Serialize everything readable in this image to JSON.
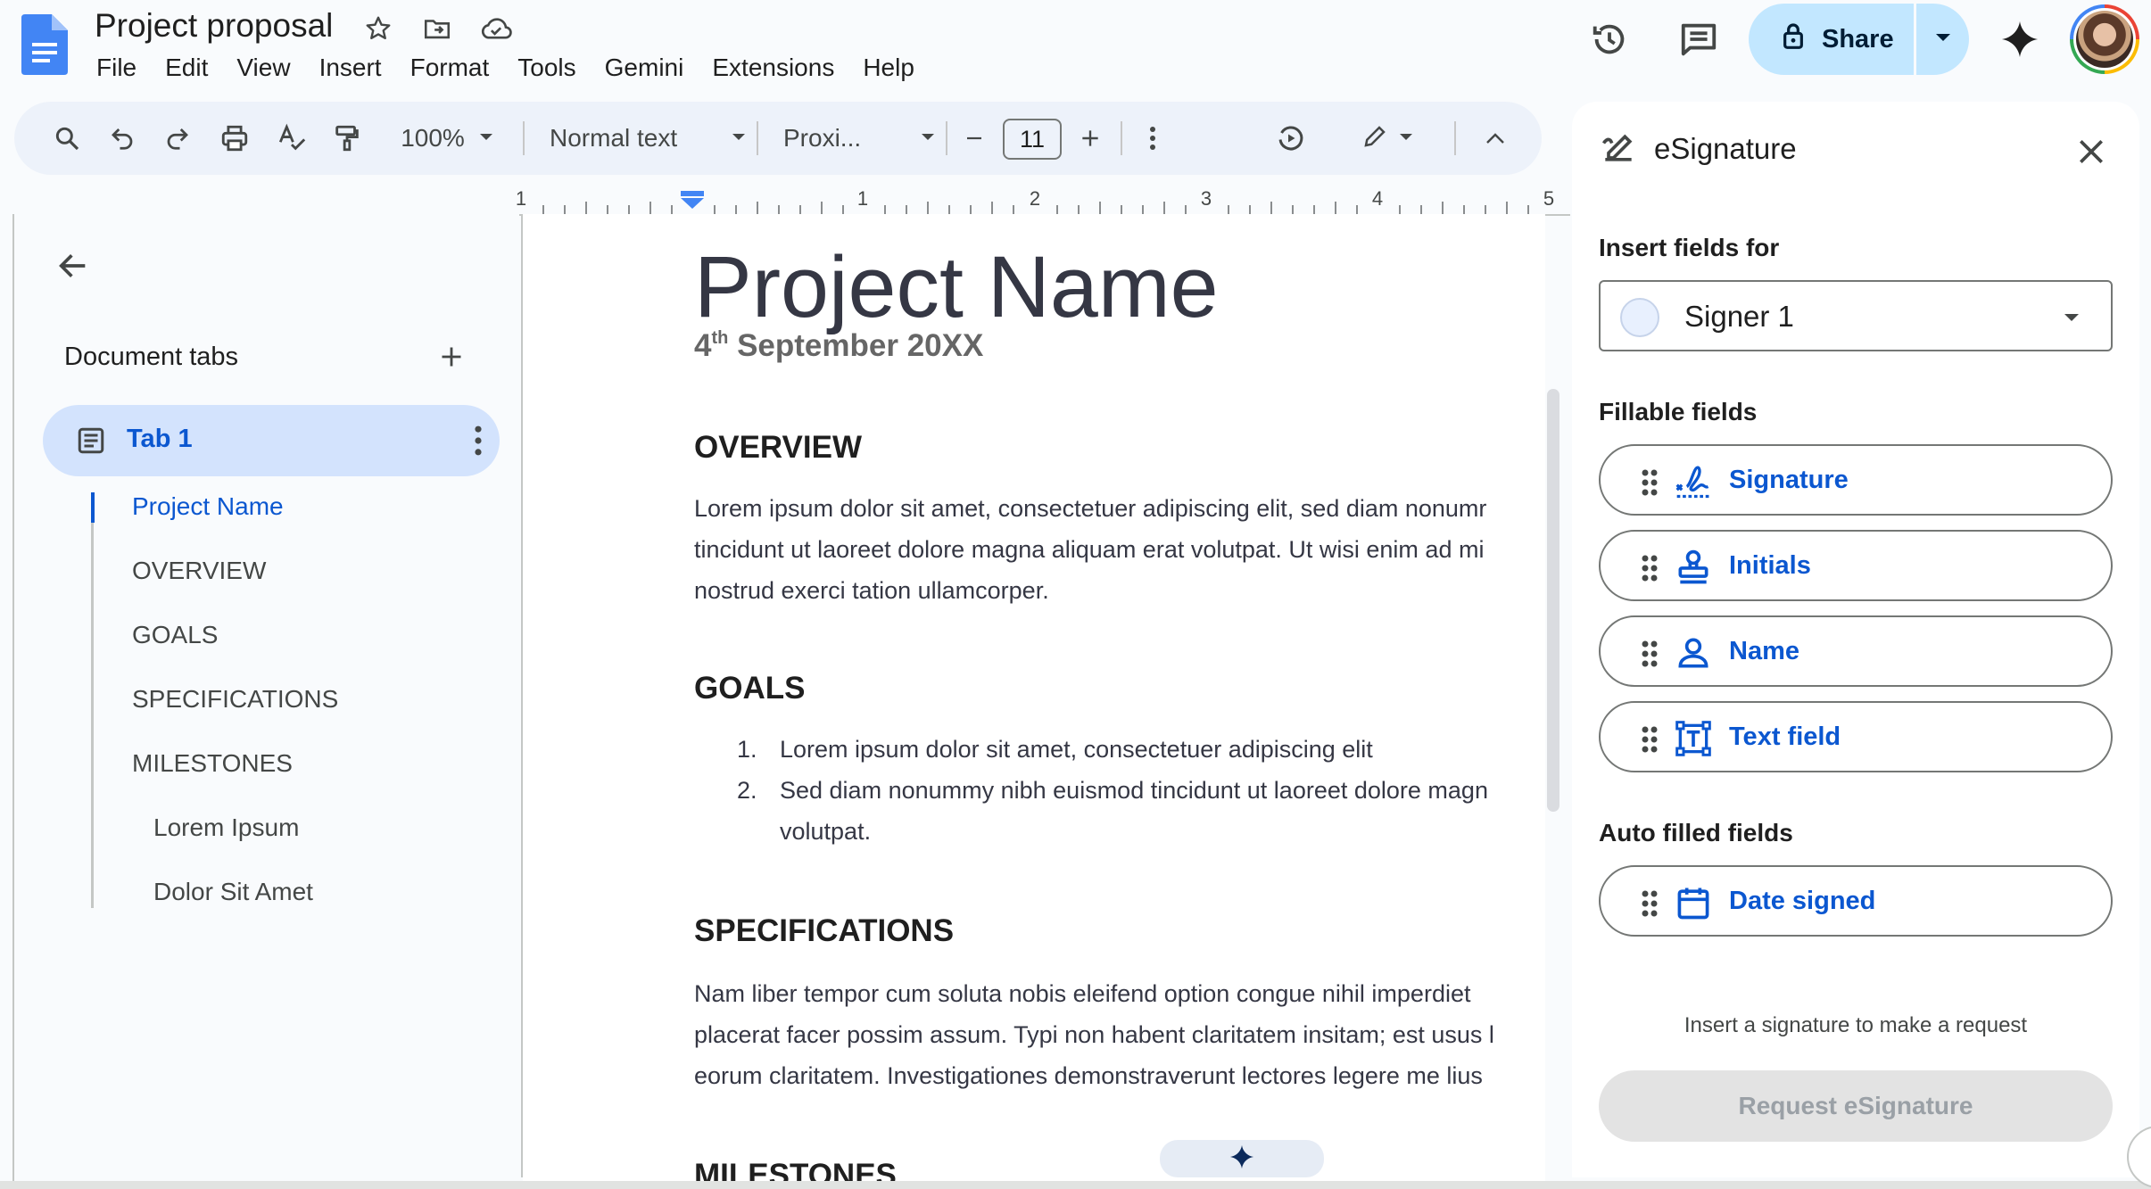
{
  "app": {
    "title": "Project proposal",
    "menu": [
      "File",
      "Edit",
      "View",
      "Insert",
      "Format",
      "Tools",
      "Gemini",
      "Extensions",
      "Help"
    ],
    "share_label": "Share",
    "accent": "#0b57d0",
    "share_bg": "#c2e7ff"
  },
  "toolbar": {
    "zoom": "100%",
    "style": "Normal text",
    "font": "Proxi...",
    "font_size": "11"
  },
  "ruler": {
    "labels": [
      "1",
      "1",
      "2",
      "3",
      "4",
      "5"
    ]
  },
  "outline": {
    "header": "Document tabs",
    "tab_label": "Tab 1",
    "items": [
      {
        "label": "Project Name",
        "level": 1,
        "active": true
      },
      {
        "label": "OVERVIEW",
        "level": 1
      },
      {
        "label": "GOALS",
        "level": 1
      },
      {
        "label": "SPECIFICATIONS",
        "level": 1
      },
      {
        "label": "MILESTONES",
        "level": 1
      },
      {
        "label": "Lorem Ipsum",
        "level": 2
      },
      {
        "label": "Dolor Sit Amet",
        "level": 2
      }
    ]
  },
  "document": {
    "title": "Project Name",
    "date_day": "4",
    "date_sup": "th",
    "date_rest": " September 20XX",
    "overview_heading": "OVERVIEW",
    "overview_lines": [
      "Lorem ipsum dolor sit amet, consectetuer adipiscing elit, sed diam nonumr",
      "tincidunt ut laoreet dolore magna aliquam erat volutpat. Ut wisi enim ad mi",
      "nostrud exerci tation ullamcorper."
    ],
    "goals_heading": "GOALS",
    "goals": [
      {
        "num": "1.",
        "lines": [
          "Lorem ipsum dolor sit amet, consectetuer adipiscing elit"
        ]
      },
      {
        "num": "2.",
        "lines": [
          "Sed diam nonummy nibh euismod tincidunt ut laoreet dolore magn",
          "volutpat."
        ]
      }
    ],
    "spec_heading": "SPECIFICATIONS",
    "spec_lines": [
      "Nam liber tempor cum soluta nobis eleifend option congue nihil imperdiet",
      "placerat facer possim assum. Typi non habent claritatem insitam; est usus l",
      "eorum claritatem. Investigationes demonstraverunt lectores legere me lius"
    ],
    "milestones_heading": "MILESTONES"
  },
  "esignature": {
    "title": "eSignature",
    "insert_for_label": "Insert fields for",
    "signer": "Signer 1",
    "fillable_label": "Fillable fields",
    "fillable": [
      {
        "label": "Signature",
        "icon": "signature-icon"
      },
      {
        "label": "Initials",
        "icon": "initials-stamp-icon"
      },
      {
        "label": "Name",
        "icon": "person-icon"
      },
      {
        "label": "Text field",
        "icon": "text-field-icon"
      }
    ],
    "auto_label": "Auto filled fields",
    "auto": [
      {
        "label": "Date signed",
        "icon": "calendar-icon"
      }
    ],
    "hint": "Insert a signature to make a request",
    "request_label": "Request eSignature"
  }
}
